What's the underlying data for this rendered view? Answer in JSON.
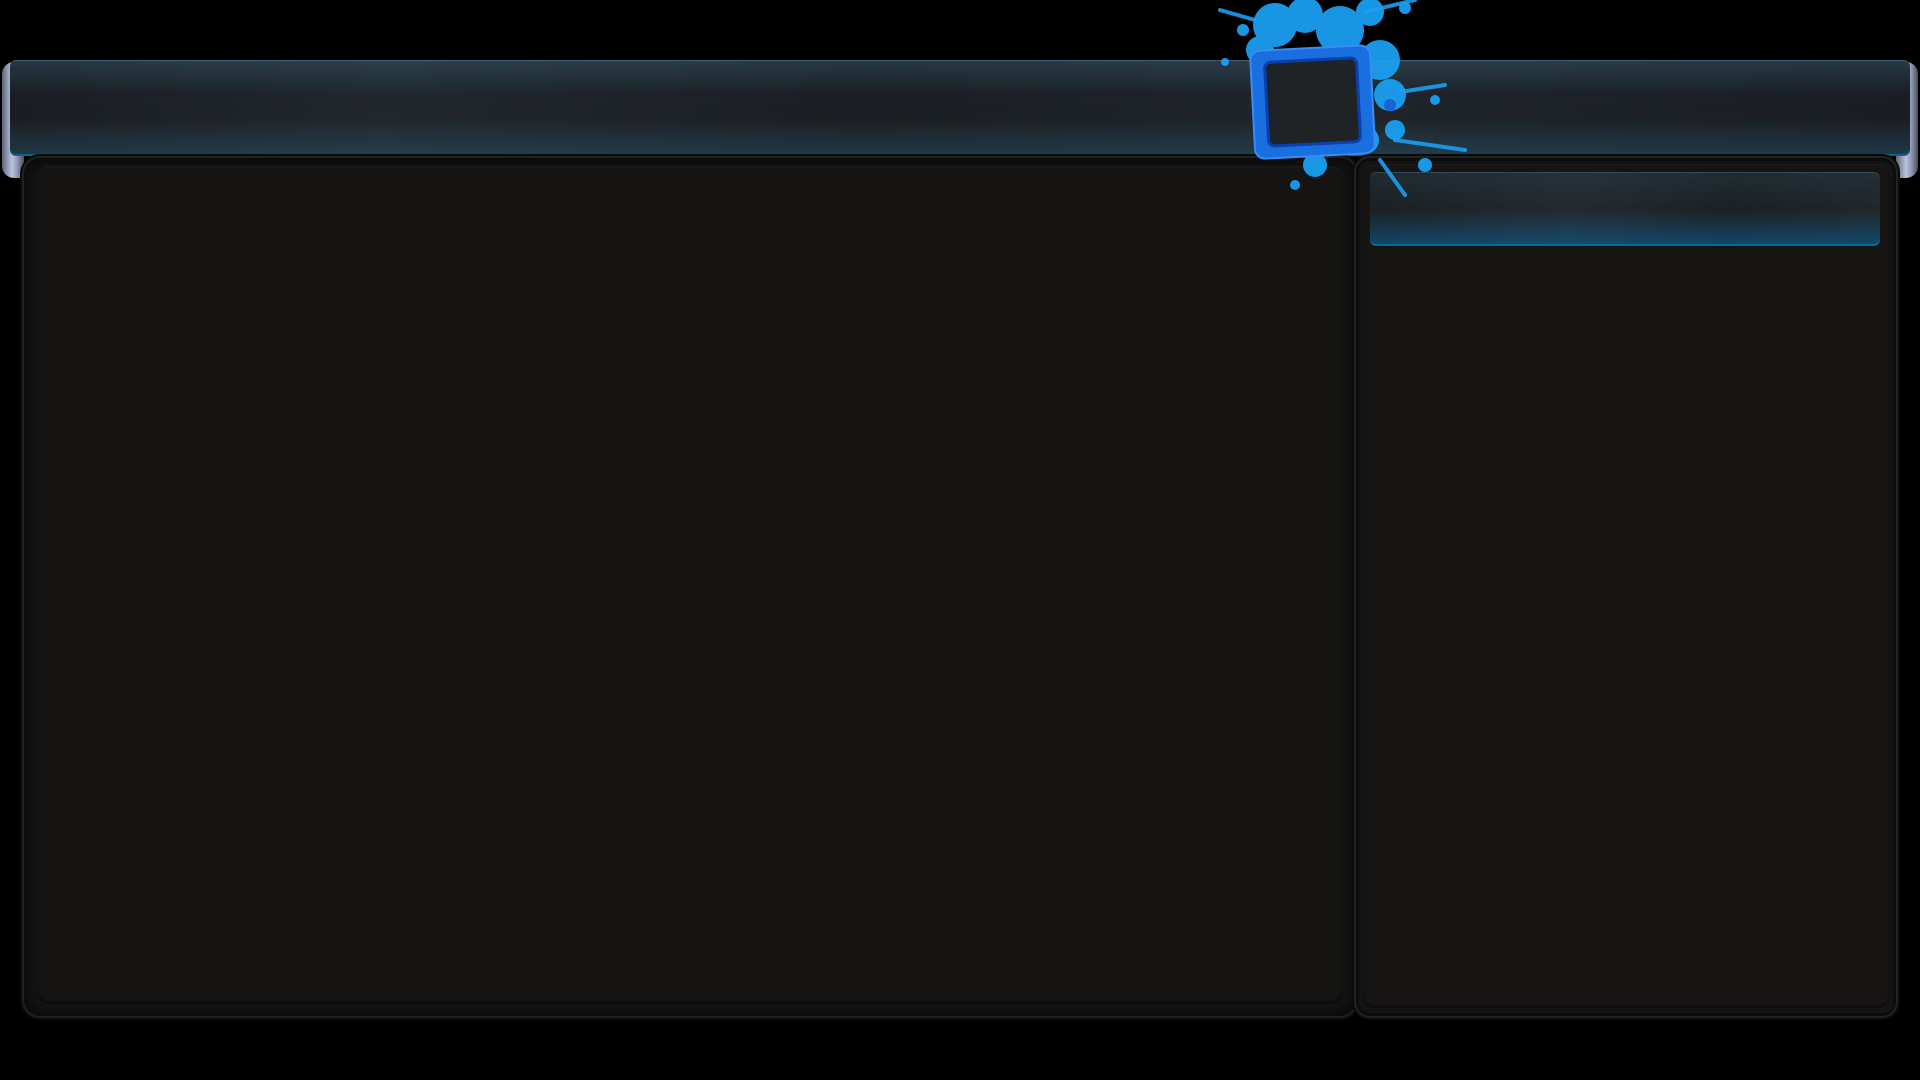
{
  "window": {
    "title": ""
  },
  "header": {
    "title": ""
  },
  "sidebar": {
    "header_label": ""
  },
  "logo": {
    "icon": "paint-splash-square-logo",
    "colors": {
      "primary": "#1a6fe0",
      "splash": "#1ca0f0",
      "outline": "#0b3fb0"
    }
  },
  "theme": {
    "background": "#000000",
    "panel": "#151414",
    "accent": "#0a8fd8",
    "cap": "#b9c3dc"
  }
}
